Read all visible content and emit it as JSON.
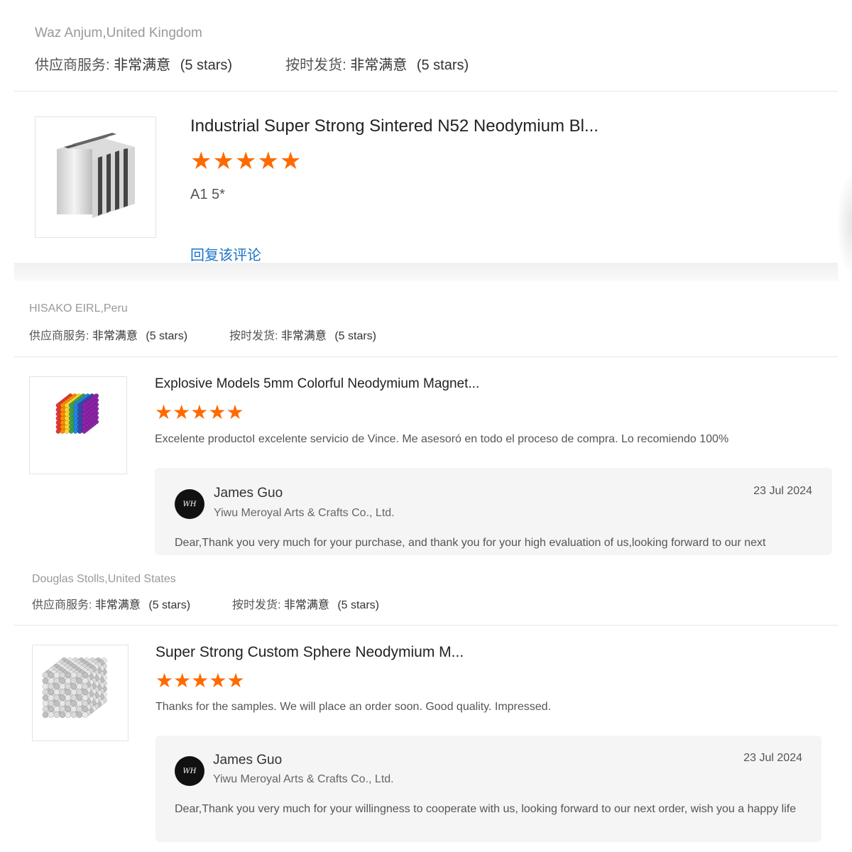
{
  "reviews": [
    {
      "reviewer": "Waz Anjum,United Kingdom",
      "supplier_service_label": "供应商服务:",
      "supplier_service_value": "非常满意",
      "supplier_service_stars": "(5 stars)",
      "ontime_label": "按时发货:",
      "ontime_value": "非常满意",
      "ontime_stars": "(5 stars)",
      "product_title": "Industrial Super Strong Sintered N52 Neodymium Bl...",
      "rating": 5,
      "review_text": "A1 5*",
      "reply_link": "回复该评论"
    },
    {
      "reviewer": "HISAKO EIRL,Peru",
      "supplier_service_label": "供应商服务:",
      "supplier_service_value": "非常满意",
      "supplier_service_stars": "(5 stars)",
      "ontime_label": "按时发货:",
      "ontime_value": "非常满意",
      "ontime_stars": "(5 stars)",
      "product_title": "Explosive Models 5mm Colorful Neodymium Magnet...",
      "rating": 5,
      "review_text": "Excelente productoI excelente servicio de Vince. Me asesoró en todo el proceso de compra. Lo recomiendo 100%",
      "reply": {
        "name": "James Guo",
        "company": "Yiwu Meroyal Arts & Crafts Co., Ltd.",
        "date": "23 Jul 2024",
        "message": "Dear,Thank you very much for your purchase, and thank you for your high evaluation of us,looking forward to our next"
      }
    },
    {
      "reviewer": "Douglas Stolls,United States",
      "supplier_service_label": "供应商服务:",
      "supplier_service_value": "非常满意",
      "supplier_service_stars": "(5 stars)",
      "ontime_label": "按时发货:",
      "ontime_value": "非常满意",
      "ontime_stars": "(5 stars)",
      "product_title": "Super Strong Custom Sphere Neodymium M...",
      "rating": 5,
      "review_text": "Thanks for the samples. We will place an order soon. Good quality. Impressed.",
      "reply": {
        "name": "James Guo",
        "company": "Yiwu Meroyal Arts & Crafts Co., Ltd.",
        "date": "23 Jul 2024",
        "message": "Dear,Thank you very much for your willingness to cooperate with us, looking forward to our next order, wish you a happy life"
      }
    }
  ],
  "icons": {
    "star": "star-icon",
    "avatar_initials": "WH"
  },
  "colors": {
    "star": "#ff6a00",
    "link": "#1a73c7",
    "reply_bg": "#f5f5f5"
  }
}
